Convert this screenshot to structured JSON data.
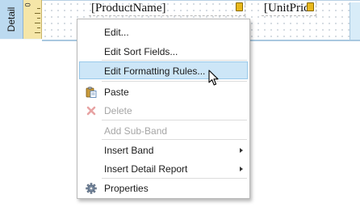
{
  "band": {
    "label": "Detail",
    "ruler_number": "0",
    "fields": [
      {
        "text": "[ProductName]"
      },
      {
        "text": "[UnitPric"
      }
    ]
  },
  "context_menu": {
    "items": [
      {
        "label": "Edit...",
        "state": "normal"
      },
      {
        "label": "Edit Sort Fields...",
        "state": "normal"
      },
      {
        "label": "Edit Formatting Rules...",
        "state": "hover"
      },
      {
        "label": "Paste",
        "icon": "paste-icon",
        "state": "normal"
      },
      {
        "label": "Delete",
        "icon": "delete-icon",
        "state": "disabled"
      },
      {
        "label": "Add Sub-Band",
        "state": "disabled"
      },
      {
        "label": "Insert Band",
        "submenu": true,
        "state": "normal"
      },
      {
        "label": "Insert Detail Report",
        "submenu": true,
        "state": "normal"
      },
      {
        "label": "Properties",
        "icon": "gear-icon",
        "state": "normal"
      }
    ]
  },
  "colors": {
    "hover_bg": "#cde6f7",
    "hover_border": "#99c9ea",
    "band_tab": "#bcdaf0",
    "ruler": "#f5e6a8",
    "field_tag": "#e8b81c"
  }
}
